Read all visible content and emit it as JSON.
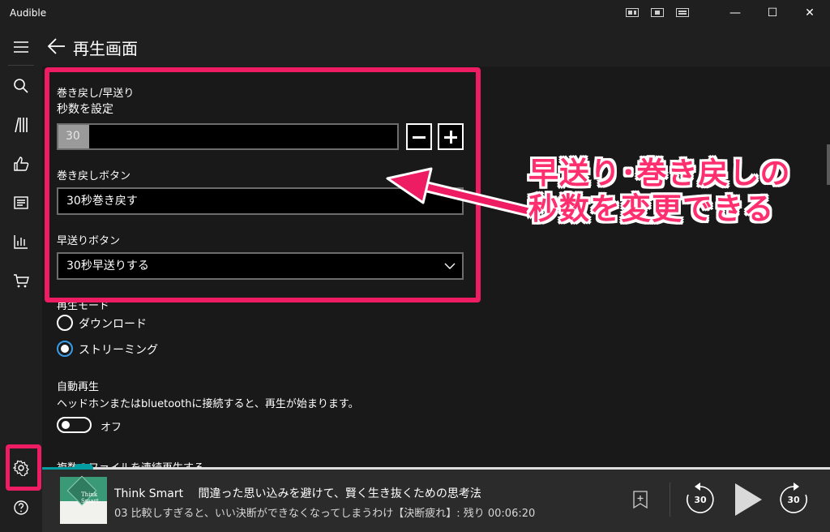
{
  "window": {
    "app_title": "Audible",
    "minimize": "—",
    "maximize": "☐",
    "close": "✕"
  },
  "header": {
    "title": "再生画面"
  },
  "settings": {
    "skip_group_label": "巻き戻し/早送り",
    "seconds_label": "秒数を設定",
    "seconds_value": "30",
    "seconds_fill_fraction": 0.09,
    "rewind_label": "巻き戻しボタン",
    "rewind_value": "30秒巻き戻す",
    "forward_label": "早送りボタン",
    "forward_value": "30秒早送りする",
    "playback_mode_label": "再生モード",
    "download_option": "ダウンロード",
    "streaming_option": "ストリーミング",
    "selected_mode": "ストリーミング",
    "autoplay_label": "自動再生",
    "autoplay_desc": "ヘッドホンまたはbluetoothに接続すると、再生が始まります。",
    "autoplay_state": "オフ",
    "continuous_label": "複数のファイルを連続再生する"
  },
  "annotation": {
    "line1": "早送り･巻き戻しの",
    "line2": "秒数を変更できる",
    "color": "#ee1d63"
  },
  "player": {
    "book_title": "Think Smart　 間違った思い込みを避けて、賢く生き抜くための思考法",
    "chapter": "03 比較しすぎると、いい決断ができなくなってしまうわけ【決断疲れ】:  残り 00:06:20",
    "cover_text_1": "Think",
    "cover_text_2": "Smart",
    "rewind_seconds": "30",
    "forward_seconds": "30",
    "progress_fraction": 0.05,
    "accent": "#049ea2"
  }
}
